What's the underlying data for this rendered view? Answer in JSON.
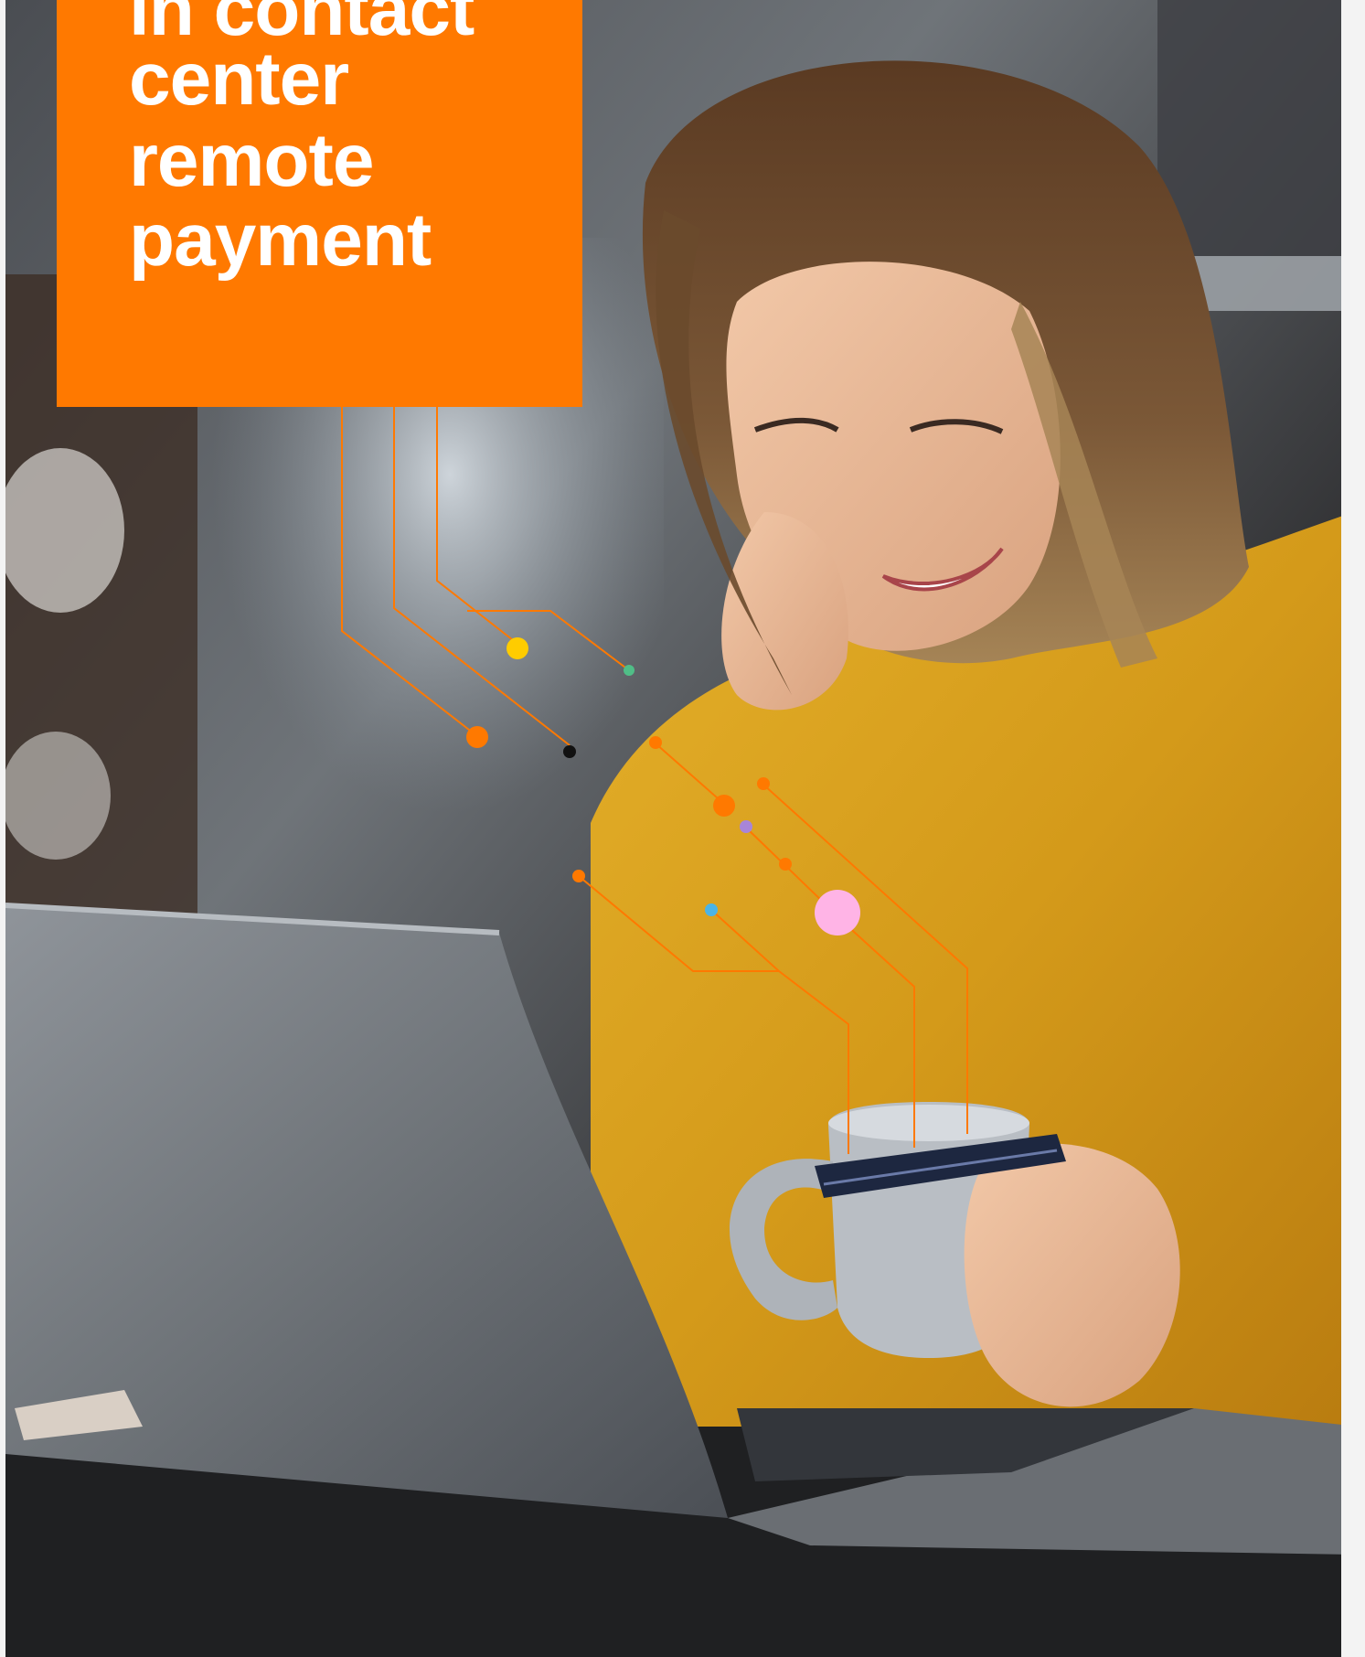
{
  "cover": {
    "title_lines": [
      "in contact",
      "center",
      "remote",
      "payment"
    ],
    "accent_color": "#ff7900"
  },
  "photo": {
    "subject": "woman-with-laptop-and-card-icon"
  }
}
